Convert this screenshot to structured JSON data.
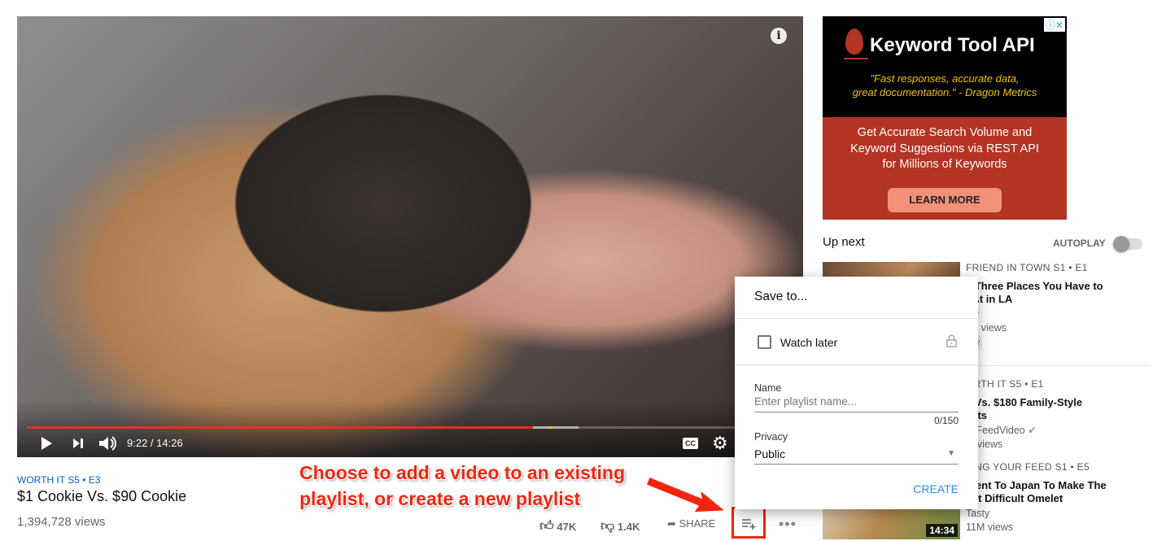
{
  "player": {
    "current_time": "9:22",
    "duration": "14:26",
    "time_display": "9:22 / 14:26",
    "progress_played_pct": 66,
    "progress_buffered_pct": 72,
    "icons": [
      "play-icon",
      "next-icon",
      "volume-icon",
      "cc-icon",
      "settings-icon",
      "info-icon"
    ]
  },
  "video": {
    "series": "WORTH IT  S5 • E3",
    "title": "$1 Cookie Vs. $90 Cookie",
    "views": "1,394,728 views",
    "likes": "47K",
    "dislikes": "1.4K",
    "share_label": "SHARE",
    "series_color": "#065fd4"
  },
  "ad": {
    "title": "Keyword Tool API",
    "quote_line1": "\"Fast responses, accurate data,",
    "quote_line2": "great documentation.\" - Dragon Metrics",
    "body_line1": "Get Accurate Search Volume and",
    "body_line2": "Keyword Suggestions via REST API",
    "body_line3": "for Millions of Keywords",
    "cta": "LEARN MORE"
  },
  "sidebar": {
    "up_next": "Up next",
    "autoplay": "AUTOPLAY",
    "autoplay_on": false,
    "items": [
      {
        "meta": "FRIEND IN TOWN  S1 • E1",
        "title_line1": "e Three Places You Have to",
        "title_line2": "t At in LA",
        "channel": "sty",
        "views": "4K views",
        "badge": "ew"
      },
      {
        "meta": "ORTH IT  S5 • E1",
        "title_line1": "9 Vs. $180 Family-Style",
        "title_line2": "eats",
        "channel": "zzFeedVideo",
        "views": "M views"
      },
      {
        "meta": "TING YOUR FEED  S1 • E5",
        "title_line1": "Went To Japan To Make The",
        "title_line2": "ost Difficult Omelet",
        "channel": "Tasty",
        "views": "11M views",
        "duration": "14:34"
      }
    ]
  },
  "popup": {
    "title": "Save to...",
    "watch_later": "Watch later",
    "watch_later_checked": false,
    "name_label": "Name",
    "name_placeholder": "Enter playlist name...",
    "counter": "0/150",
    "privacy_label": "Privacy",
    "privacy_value": "Public",
    "create": "CREATE"
  },
  "annotation": {
    "line1": "Choose to add a video to an existing",
    "line2": "playlist,  or create a new playlist",
    "color": "#f2250e"
  }
}
